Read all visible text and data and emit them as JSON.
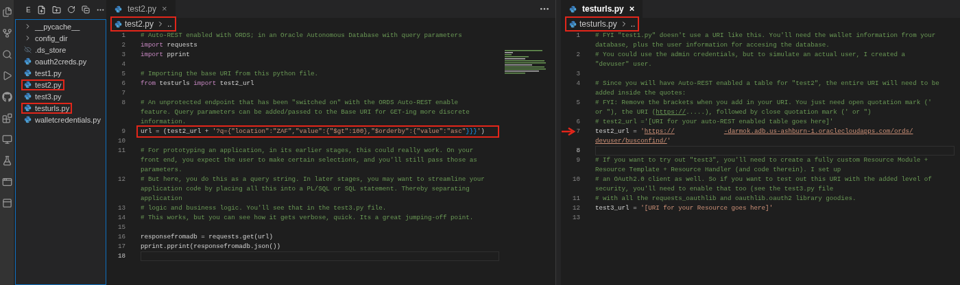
{
  "explorer": {
    "toolbar_label": "E",
    "items": [
      {
        "label": "__pycache__",
        "kind": "folder",
        "highlighted": false
      },
      {
        "label": "config_dir",
        "kind": "folder",
        "highlighted": false
      },
      {
        "label": ".ds_store",
        "kind": "hidden",
        "highlighted": false
      },
      {
        "label": "oauth2creds.py",
        "kind": "python",
        "highlighted": false
      },
      {
        "label": "test1.py",
        "kind": "python",
        "highlighted": false
      },
      {
        "label": "test2.py",
        "kind": "python",
        "highlighted": true
      },
      {
        "label": "test3.py",
        "kind": "python",
        "highlighted": false
      },
      {
        "label": "testurls.py",
        "kind": "python",
        "highlighted": true
      },
      {
        "label": "walletcredentials.py",
        "kind": "python",
        "highlighted": false
      }
    ]
  },
  "editors": [
    {
      "tab": {
        "label": "test2.py",
        "close": "×",
        "focused": false
      },
      "breadcrumb": {
        "file": "test2.py",
        "more": "..",
        "highlighted": true
      },
      "lines": [
        {
          "number": "1",
          "wraps": [
            {
              "parts": [
                {
                  "kind": "comment",
                  "text": "# Auto-REST enabled with ORDS; in an Oracle Autonomous Database with query parameters"
                }
              ]
            }
          ]
        },
        {
          "number": "2",
          "wraps": [
            {
              "parts": [
                {
                  "kind": "keyword",
                  "text": "import"
                },
                {
                  "kind": "plain",
                  "text": " requests"
                }
              ]
            }
          ]
        },
        {
          "number": "3",
          "wraps": [
            {
              "parts": [
                {
                  "kind": "keyword",
                  "text": "import"
                },
                {
                  "kind": "plain",
                  "text": " pprint"
                }
              ]
            }
          ]
        },
        {
          "number": "4"
        },
        {
          "number": "5",
          "wraps": [
            {
              "parts": [
                {
                  "kind": "comment",
                  "text": "# Importing the base URI from this python file."
                }
              ]
            }
          ]
        },
        {
          "number": "6",
          "wraps": [
            {
              "parts": [
                {
                  "kind": "keyword",
                  "text": "from"
                },
                {
                  "kind": "plain",
                  "text": " testurls "
                },
                {
                  "kind": "keyword",
                  "text": "import"
                },
                {
                  "kind": "plain",
                  "text": " test2_url"
                }
              ]
            }
          ]
        },
        {
          "number": "7"
        },
        {
          "number": "8",
          "wraps": [
            {
              "parts": [
                {
                  "kind": "comment",
                  "text": "# An unprotected endpoint that has been \"switched on\" with the ORDS Auto-REST enable"
                }
              ]
            },
            {
              "parts": [
                {
                  "kind": "comment",
                  "text": "feature. Query parameters can be added/passed to the Base URI for GET-ing more discrete"
                }
              ]
            },
            {
              "parts": [
                {
                  "kind": "comment",
                  "text": "information."
                }
              ]
            }
          ]
        },
        {
          "number": "9",
          "highlighted": true,
          "wraps": [
            {
              "parts": [
                {
                  "kind": "plain",
                  "text": "url = (test2_url + "
                },
                {
                  "kind": "string",
                  "text": "'?q={\"location\":\"ZAF\",\"value\":{\"$gt\":100},\"$orderby\":{\"value\":\"asc\""
                },
                {
                  "kind": "bracket",
                  "text": "}}}"
                },
                {
                  "kind": "string",
                  "text": "'"
                },
                {
                  "kind": "plain",
                  "text": ")"
                }
              ]
            }
          ]
        },
        {
          "number": "10"
        },
        {
          "number": "11",
          "wraps": [
            {
              "parts": [
                {
                  "kind": "comment",
                  "text": "# For prototyping an application, in its earlier stages, this could really work. On your"
                }
              ]
            },
            {
              "parts": [
                {
                  "kind": "comment",
                  "text": "front end, you expect the user to make certain selections, and you'll still pass those as"
                }
              ]
            },
            {
              "parts": [
                {
                  "kind": "comment",
                  "text": "parameters."
                }
              ]
            }
          ]
        },
        {
          "number": "12",
          "wraps": [
            {
              "parts": [
                {
                  "kind": "comment",
                  "text": "# But here, you do this as a query string. In later stages, you may want to streamline your"
                }
              ]
            },
            {
              "parts": [
                {
                  "kind": "comment",
                  "text": "application code by placing all this into a PL/SQL or SQL statement. Thereby separating"
                }
              ]
            },
            {
              "parts": [
                {
                  "kind": "comment",
                  "text": "application"
                }
              ]
            }
          ]
        },
        {
          "number": "13",
          "wraps": [
            {
              "parts": [
                {
                  "kind": "comment",
                  "text": "# logic and business logic. You'll see that in the test3.py file."
                }
              ]
            }
          ]
        },
        {
          "number": "14",
          "wraps": [
            {
              "parts": [
                {
                  "kind": "comment",
                  "text": "# This works, but you can see how it gets verbose, quick. Its a great jumping-off point."
                }
              ]
            }
          ]
        },
        {
          "number": "15"
        },
        {
          "number": "16",
          "wraps": [
            {
              "parts": [
                {
                  "kind": "plain",
                  "text": "responsefromadb = requests.get(url)"
                }
              ]
            }
          ]
        },
        {
          "number": "17",
          "wraps": [
            {
              "parts": [
                {
                  "kind": "plain",
                  "text": "pprint.pprint(responsefromadb.json())"
                }
              ]
            }
          ]
        },
        {
          "number": "18",
          "current": true
        }
      ]
    },
    {
      "tab": {
        "label": "testurls.py",
        "close": "×",
        "focused": true
      },
      "breadcrumb": {
        "file": "testurls.py",
        "more": "..",
        "highlighted": true
      },
      "lines": [
        {
          "number": "1",
          "wraps": [
            {
              "parts": [
                {
                  "kind": "comment",
                  "text": "# FYI \"test1.py\" doesn't use a URI like this. You'll need the wallet information from your"
                }
              ]
            },
            {
              "parts": [
                {
                  "kind": "comment",
                  "text": "database, plus the user information for accesing the database."
                }
              ]
            }
          ]
        },
        {
          "number": "2",
          "wraps": [
            {
              "parts": [
                {
                  "kind": "comment",
                  "text": "# You could use the admin credentials, but to simulate an actual user, I created a"
                }
              ]
            },
            {
              "parts": [
                {
                  "kind": "comment",
                  "text": "\"devuser\" user."
                }
              ]
            }
          ]
        },
        {
          "number": "3"
        },
        {
          "number": "4",
          "wraps": [
            {
              "parts": [
                {
                  "kind": "comment",
                  "text": "# Since you will have Auto-REST enabled a table for \"test2\", the entire URI will need to be"
                }
              ]
            },
            {
              "parts": [
                {
                  "kind": "comment",
                  "text": "added inside the quotes:"
                }
              ]
            }
          ]
        },
        {
          "number": "5",
          "wraps": [
            {
              "parts": [
                {
                  "kind": "comment",
                  "text": "# FYI: Remove the brackets when you add in your URI. You just need open quotation mark ('"
                }
              ]
            },
            {
              "parts": [
                {
                  "kind": "comment",
                  "text": "or \"), the URI ("
                },
                {
                  "kind": "link",
                  "text": "https://"
                },
                {
                  "kind": "comment",
                  "text": "....."
                },
                {
                  "kind": "comment",
                  "text": "), followed by close quotation mark (' or \")"
                }
              ]
            }
          ]
        },
        {
          "number": "6",
          "wraps": [
            {
              "parts": [
                {
                  "kind": "comment",
                  "text": "# test2_url ='[URI for your auto-REST enabled table goes here]'"
                }
              ]
            }
          ]
        },
        {
          "number": "7",
          "arrow": true,
          "wraps": [
            {
              "parts": [
                {
                  "kind": "plain",
                  "text": "test2_url = "
                },
                {
                  "kind": "string",
                  "text": "'"
                },
                {
                  "kind": "url",
                  "text": "https://"
                },
                {
                  "kind": "redacted"
                },
                {
                  "kind": "url",
                  "text": "-darmok.adb.us-ashburn-1.oraclecloudapps.com/ords/"
                }
              ]
            },
            {
              "parts": [
                {
                  "kind": "url",
                  "text": "devuser/busconfind/"
                },
                {
                  "kind": "string",
                  "text": "'"
                }
              ]
            }
          ]
        },
        {
          "number": "8",
          "current": true
        },
        {
          "number": "9",
          "wraps": [
            {
              "parts": [
                {
                  "kind": "comment",
                  "text": "# If you want to try out \"test3\", you'll need to create a fully custom Resource Module +"
                }
              ]
            },
            {
              "parts": [
                {
                  "kind": "comment",
                  "text": "Resource Template + Resource Handler (and code therein). I set up"
                }
              ]
            }
          ]
        },
        {
          "number": "10",
          "wraps": [
            {
              "parts": [
                {
                  "kind": "comment",
                  "text": "# an OAuth2.0 client as well. So if you want to test out this URI with the added level of"
                }
              ]
            },
            {
              "parts": [
                {
                  "kind": "comment",
                  "text": "security, you'll need to enable that too (see the test3.py file"
                }
              ]
            }
          ]
        },
        {
          "number": "11",
          "wraps": [
            {
              "parts": [
                {
                  "kind": "comment",
                  "text": "# with all the requests_oauthlib and oauthlib.oauth2 library goodies."
                }
              ]
            }
          ]
        },
        {
          "number": "12",
          "wraps": [
            {
              "parts": [
                {
                  "kind": "plain",
                  "text": "test3_url = "
                },
                {
                  "kind": "string",
                  "text": "'[URI for your Resource goes here]'"
                }
              ]
            }
          ]
        },
        {
          "number": "13"
        }
      ]
    }
  ]
}
